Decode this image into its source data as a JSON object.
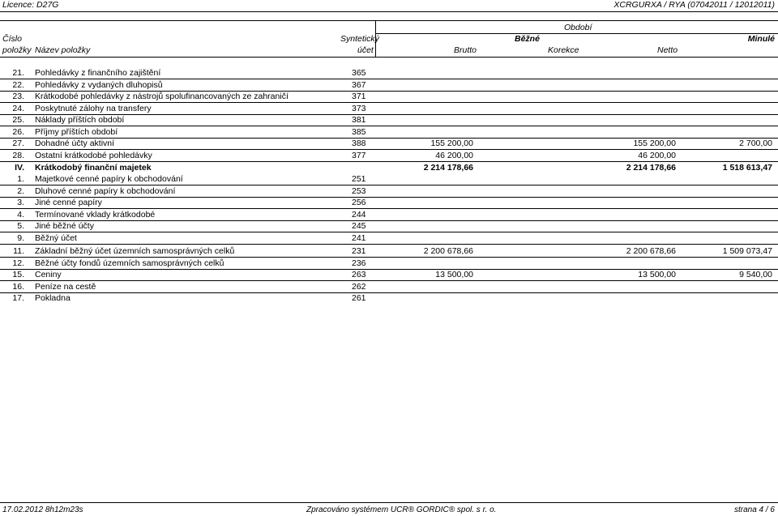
{
  "top": {
    "licence": "Licence: D27G",
    "report_code": "XCRGURXA / RYA  (07042011 / 12012011)"
  },
  "header": {
    "cislo": "Číslo",
    "polozky": "položky",
    "nazev": "Název položky",
    "synteticky": "Syntetický",
    "ucet": "účet",
    "obdobi": "Období",
    "bezne": "Běžné",
    "minule": "Minulé",
    "brutto": "Brutto",
    "korekce": "Korekce",
    "netto": "Netto"
  },
  "rows": [
    {
      "num": "21.",
      "name": "Pohledávky z finančního zajištění",
      "ucet": "365",
      "brutto": "",
      "netto": "",
      "minule": ""
    },
    {
      "num": "22.",
      "name": "Pohledávky z vydaných dluhopisů",
      "ucet": "367",
      "brutto": "",
      "netto": "",
      "minule": ""
    },
    {
      "num": "23.",
      "name": "Krátkodobé pohledávky z nástrojů spolufinancovaných ze zahraničí",
      "ucet": "371",
      "brutto": "",
      "netto": "",
      "minule": ""
    },
    {
      "num": "24.",
      "name": "Poskytnuté zálohy na transfery",
      "ucet": "373",
      "brutto": "",
      "netto": "",
      "minule": ""
    },
    {
      "num": "25.",
      "name": "Náklady příštích období",
      "ucet": "381",
      "brutto": "",
      "netto": "",
      "minule": ""
    },
    {
      "num": "26.",
      "name": "Příjmy příštích období",
      "ucet": "385",
      "brutto": "",
      "netto": "",
      "minule": ""
    },
    {
      "num": "27.",
      "name": "Dohadné účty aktivní",
      "ucet": "388",
      "brutto": "155 200,00",
      "netto": "155 200,00",
      "minule": "2 700,00"
    },
    {
      "num": "28.",
      "name": "Ostatní krátkodobé pohledávky",
      "ucet": "377",
      "brutto": "46 200,00",
      "netto": "46 200,00",
      "minule": ""
    },
    {
      "num": "IV.",
      "name": "Krátkodobý finanční majetek",
      "ucet": "",
      "brutto": "2 214 178,66",
      "netto": "2 214 178,66",
      "minule": "1 518 613,47",
      "bold": true
    },
    {
      "num": "1.",
      "name": "Majetkové cenné papíry k obchodování",
      "ucet": "251",
      "brutto": "",
      "netto": "",
      "minule": ""
    },
    {
      "num": "2.",
      "name": "Dluhové cenné papíry k obchodování",
      "ucet": "253",
      "brutto": "",
      "netto": "",
      "minule": ""
    },
    {
      "num": "3.",
      "name": "Jiné cenné papíry",
      "ucet": "256",
      "brutto": "",
      "netto": "",
      "minule": ""
    },
    {
      "num": "4.",
      "name": "Termínované vklady krátkodobé",
      "ucet": "244",
      "brutto": "",
      "netto": "",
      "minule": ""
    },
    {
      "num": "5.",
      "name": "Jiné běžné účty",
      "ucet": "245",
      "brutto": "",
      "netto": "",
      "minule": ""
    },
    {
      "num": "9.",
      "name": "Běžný účet",
      "ucet": "241",
      "brutto": "",
      "netto": "",
      "minule": ""
    },
    {
      "num": "11.",
      "name": "Základní běžný účet územních samosprávných celků",
      "ucet": "231",
      "brutto": "2 200 678,66",
      "netto": "2 200 678,66",
      "minule": "1 509 073,47"
    },
    {
      "num": "12.",
      "name": "Běžné účty fondů územních samosprávných celků",
      "ucet": "236",
      "brutto": "",
      "netto": "",
      "minule": ""
    },
    {
      "num": "15.",
      "name": "Ceniny",
      "ucet": "263",
      "brutto": "13 500,00",
      "netto": "13 500,00",
      "minule": "9 540,00"
    },
    {
      "num": "16.",
      "name": "Peníze na cestě",
      "ucet": "262",
      "brutto": "",
      "netto": "",
      "minule": ""
    },
    {
      "num": "17.",
      "name": "Pokladna",
      "ucet": "261",
      "brutto": "",
      "netto": "",
      "minule": ""
    }
  ],
  "footer": {
    "datetime": "17.02.2012 8h12m23s",
    "processed": "Zpracováno systémem UCR® GORDIC® spol. s  r. o.",
    "page": "strana 4 / 6"
  }
}
